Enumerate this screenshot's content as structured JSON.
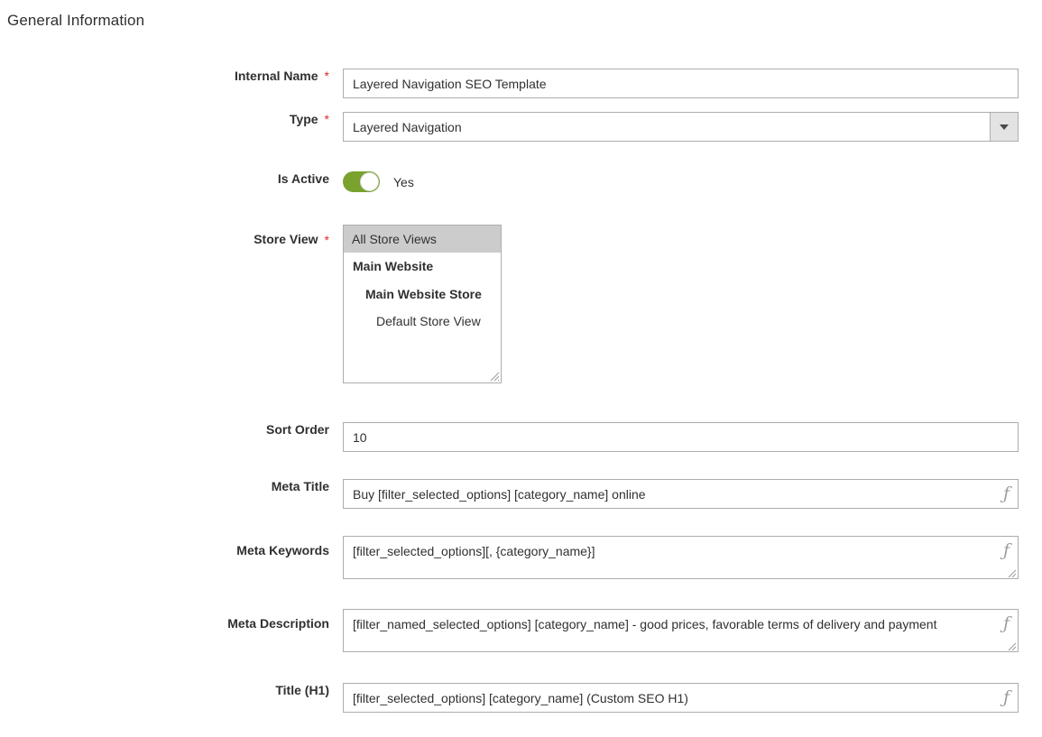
{
  "page": {
    "section_title": "General Information"
  },
  "colors": {
    "accent_green": "#79a22e",
    "required_red": "#e22626",
    "text": "#303030",
    "border": "#adadad",
    "select_button": "#e3e3e3",
    "multiselect_selected": "#cccccc"
  },
  "fields": {
    "internal_name": {
      "label": "Internal Name",
      "required": "*",
      "value": "Layered Navigation SEO Template"
    },
    "type": {
      "label": "Type",
      "required": "*",
      "value": "Layered Navigation",
      "arrow_icon": "chevron-down-icon"
    },
    "is_active": {
      "label": "Is Active",
      "state_label": "Yes",
      "checked": true
    },
    "store_view": {
      "label": "Store View",
      "required": "*",
      "options": [
        {
          "label": "All Store Views",
          "level": "all",
          "selected": true
        },
        {
          "label": "Main Website",
          "level": "website",
          "selected": false
        },
        {
          "label": "Main Website Store",
          "level": "store",
          "selected": false
        },
        {
          "label": "Default Store View",
          "level": "view",
          "selected": false
        }
      ],
      "resize_icon": "resize-grip-icon"
    },
    "sort_order": {
      "label": "Sort Order",
      "value": "10"
    },
    "meta_title": {
      "label": "Meta Title",
      "value": "Buy [filter_selected_options] [category_name] online",
      "fx_icon": "function-variable-icon"
    },
    "meta_keywords": {
      "label": "Meta Keywords",
      "value": "[filter_selected_options][, {category_name}]",
      "fx_icon": "function-variable-icon"
    },
    "meta_description": {
      "label": "Meta Description",
      "value": "[filter_named_selected_options] [category_name] - good prices, favorable terms of delivery and payment",
      "fx_icon": "function-variable-icon"
    },
    "title_h1": {
      "label": "Title (H1)",
      "value": "[filter_selected_options] [category_name] (Custom SEO H1)",
      "fx_icon": "function-variable-icon"
    }
  }
}
